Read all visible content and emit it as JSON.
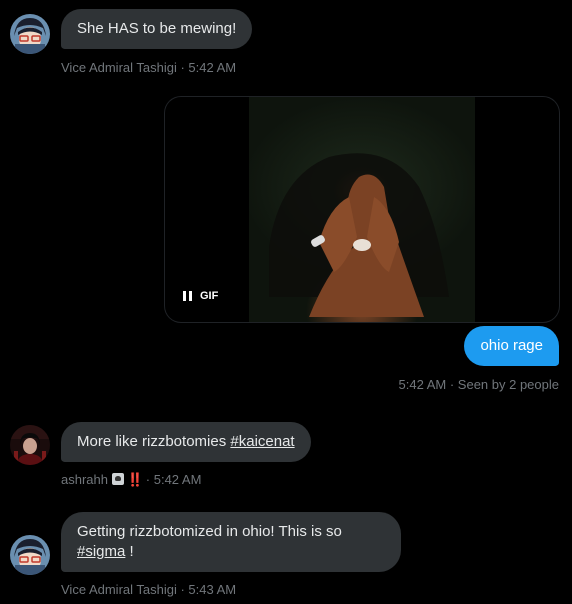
{
  "messages": [
    {
      "text": "She HAS to be mewing!",
      "sender": "Vice Admiral Tashigi",
      "time": "5:42 AM"
    },
    {
      "media_badge": "GIF"
    },
    {
      "text": "ohio rage",
      "time": "5:42 AM",
      "seen": "Seen by 2 people"
    },
    {
      "text": "More like rizzbotomies ",
      "hashtag": "#kaicenat",
      "sender": "ashrahh",
      "sender_emoji": "‼️",
      "time": "5:42 AM"
    },
    {
      "text": "Getting rizzbotomized in ohio! This is so",
      "hashtag": "#sigma",
      "suffix": " !",
      "sender": "Vice Admiral Tashigi",
      "time": "5:43 AM"
    }
  ],
  "separator": " · ",
  "colors": {
    "sent_bubble": "#1d9bf0",
    "received_bubble": "#2f3336",
    "meta_text": "#71767b"
  }
}
